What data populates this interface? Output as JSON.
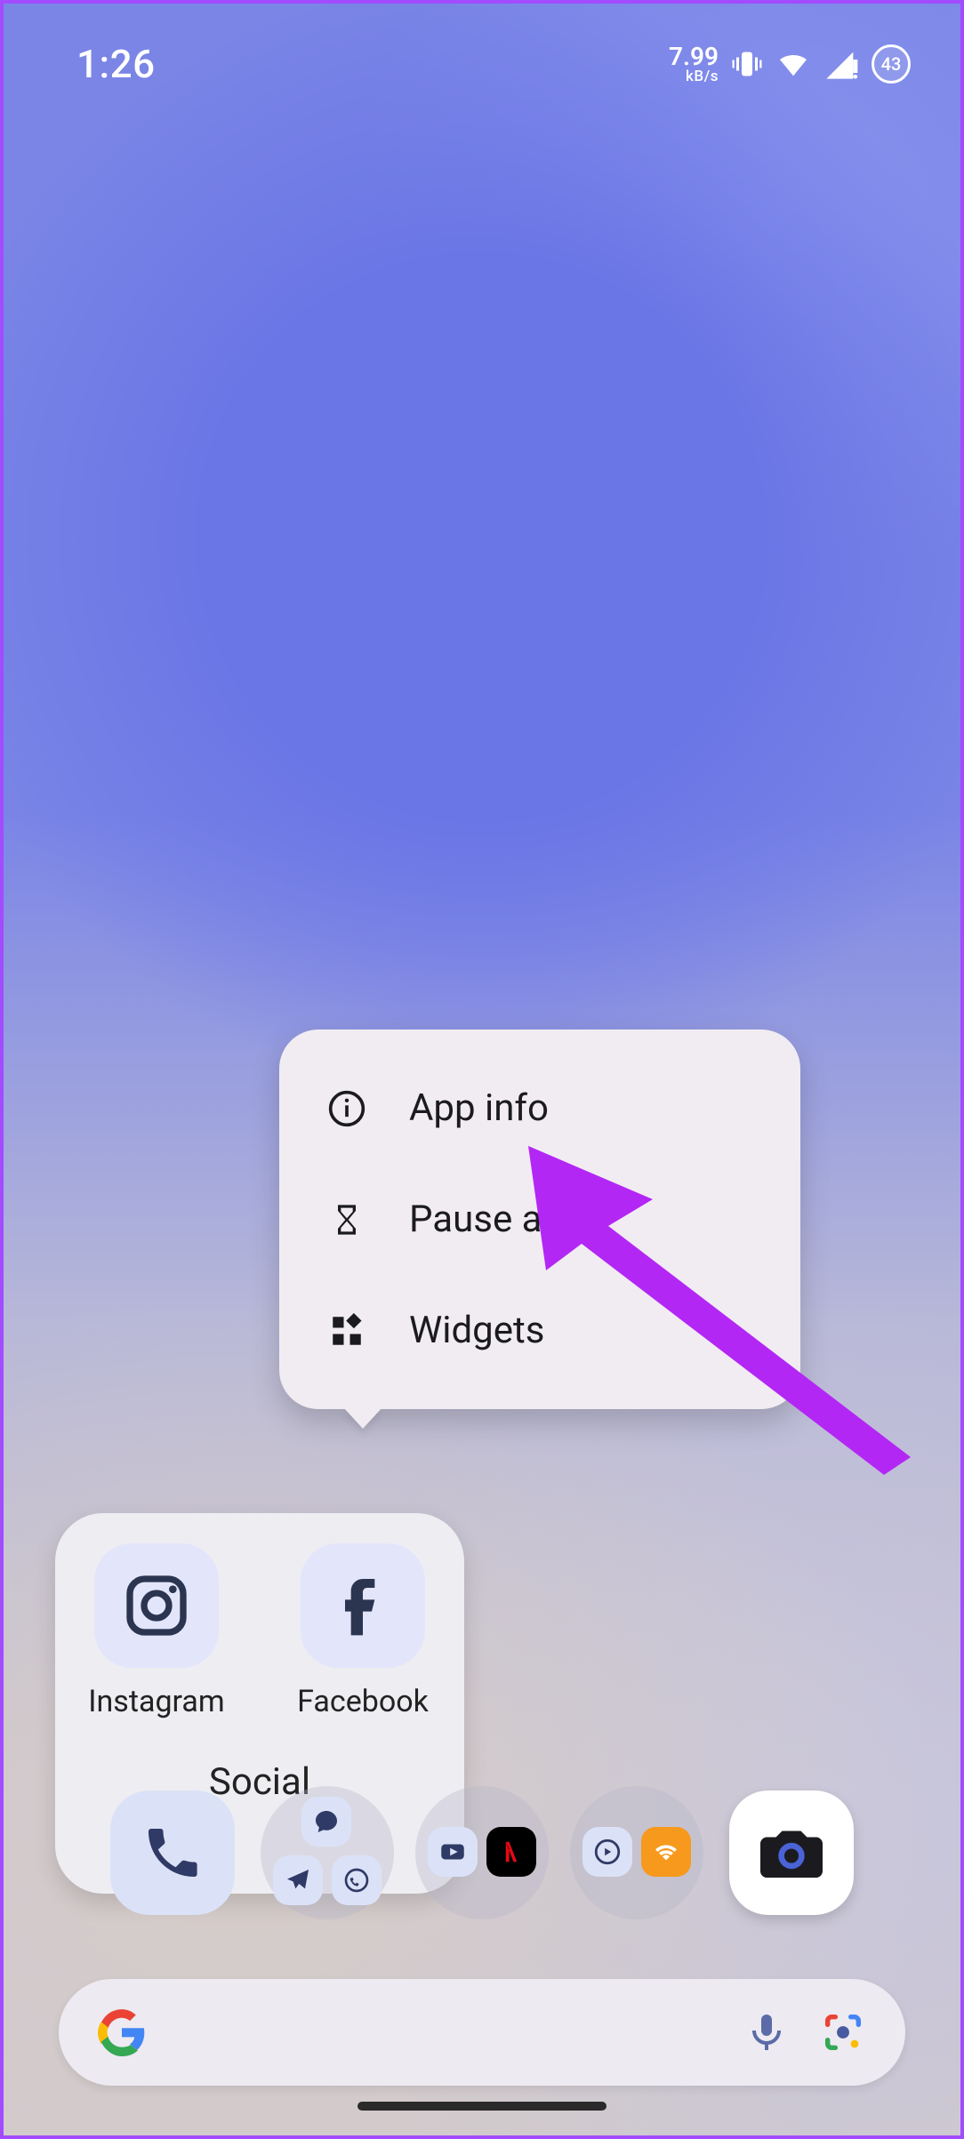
{
  "status": {
    "time": "1:26",
    "net_speed_value": "7.99",
    "net_speed_unit": "kB/s",
    "battery_percent": "43"
  },
  "context_menu": {
    "items": [
      {
        "label": "App info",
        "icon": "info-icon"
      },
      {
        "label": "Pause app",
        "icon": "hourglass-icon"
      },
      {
        "label": "Widgets",
        "icon": "widgets-icon"
      }
    ]
  },
  "folder": {
    "title": "Social",
    "apps": [
      {
        "label": "Instagram",
        "name": "instagram-app"
      },
      {
        "label": "Facebook",
        "name": "facebook-app"
      }
    ]
  },
  "dock": {
    "items": [
      {
        "name": "phone-app"
      },
      {
        "name": "messaging-folder"
      },
      {
        "name": "video-folder"
      },
      {
        "name": "media-folder"
      },
      {
        "name": "camera-app"
      }
    ]
  },
  "annotation": {
    "color": "#b327f5"
  }
}
